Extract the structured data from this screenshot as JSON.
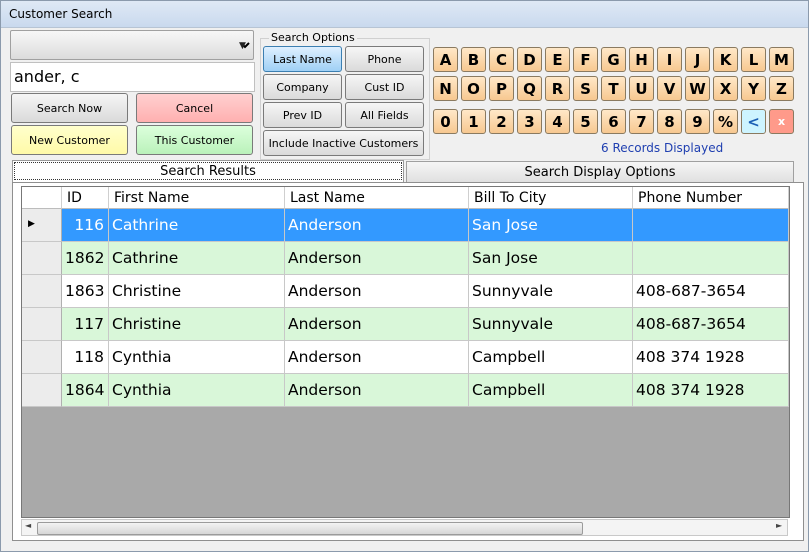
{
  "window": {
    "title": "Customer Search"
  },
  "search": {
    "value": "ander, c",
    "combo_value": ""
  },
  "buttons": {
    "search_now": "Search Now",
    "cancel": "Cancel",
    "new_customer": "New Customer",
    "this_customer": "This Customer"
  },
  "search_options": {
    "legend": "Search Options",
    "last_name": "Last Name",
    "phone": "Phone",
    "company": "Company",
    "cust_id": "Cust ID",
    "prev_id": "Prev ID",
    "all_fields": "All Fields",
    "include_inactive": "Include Inactive Customers"
  },
  "keypad": {
    "row1": [
      "A",
      "B",
      "C",
      "D",
      "E",
      "F",
      "G",
      "H",
      "I",
      "J",
      "K",
      "L",
      "M"
    ],
    "row2": [
      "N",
      "O",
      "P",
      "Q",
      "R",
      "S",
      "T",
      "U",
      "V",
      "W",
      "X",
      "Y",
      "Z"
    ],
    "row3": [
      "0",
      "1",
      "2",
      "3",
      "4",
      "5",
      "6",
      "7",
      "8",
      "9",
      "%",
      "<",
      "x"
    ]
  },
  "status": {
    "records": "6 Records Displayed"
  },
  "tabs": {
    "results": "Search Results",
    "display": "Search Display Options"
  },
  "grid": {
    "columns": [
      "ID",
      "First Name",
      "Last Name",
      "Bill To City",
      "Phone Number"
    ],
    "rows": [
      {
        "id": "116",
        "first": "Cathrine",
        "last": "Anderson",
        "city": "San Jose",
        "phone": ""
      },
      {
        "id": "1862",
        "first": "Cathrine",
        "last": "Anderson",
        "city": "San Jose",
        "phone": ""
      },
      {
        "id": "1863",
        "first": "Christine",
        "last": "Anderson",
        "city": "Sunnyvale",
        "phone": "408-687-3654"
      },
      {
        "id": "117",
        "first": "Christine",
        "last": "Anderson",
        "city": "Sunnyvale",
        "phone": "408-687-3654"
      },
      {
        "id": "118",
        "first": "Cynthia",
        "last": "Anderson",
        "city": "Campbell",
        "phone": "408 374 1928"
      },
      {
        "id": "1864",
        "first": "Cynthia",
        "last": "Anderson",
        "city": "Campbell",
        "phone": "408 374 1928"
      }
    ],
    "selected_row": 0
  },
  "colors": {
    "selected_row": "#3399ff",
    "alt_row": "#d9f7d9",
    "cancel": "#ffbcbc",
    "new_customer": "#ffffb8",
    "this_customer": "#c8f7c8",
    "key": "#f7c890",
    "key_back": "#cdf4ff",
    "key_clear": "#ff9a8a",
    "records_text": "#1f3fb0"
  }
}
